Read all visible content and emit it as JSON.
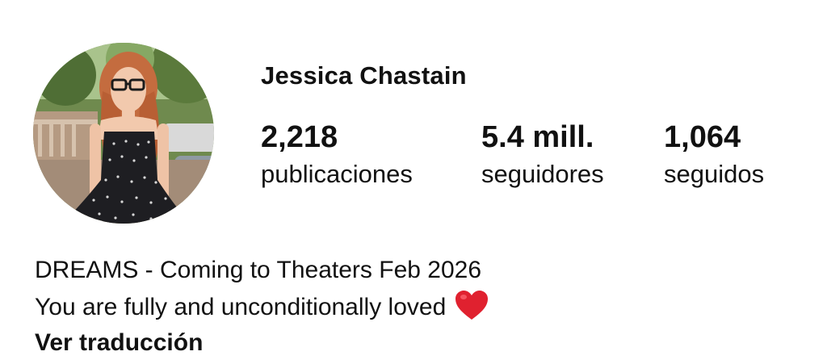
{
  "profile": {
    "name": "Jessica Chastain",
    "avatar_icon": "profile-photo"
  },
  "stats": {
    "posts": {
      "value": "2,218",
      "label": "publicaciones"
    },
    "followers": {
      "value": "5.4 mill.",
      "label": "seguidores"
    },
    "following": {
      "value": "1,064",
      "label": "seguidos"
    }
  },
  "bio": {
    "line1": "DREAMS - Coming to Theaters Feb 2026",
    "line2": "You are fully and unconditionally loved",
    "emoji_icon": "red-heart-emoji",
    "heart_color": "#e0212f",
    "translate_link": "Ver traducción"
  }
}
